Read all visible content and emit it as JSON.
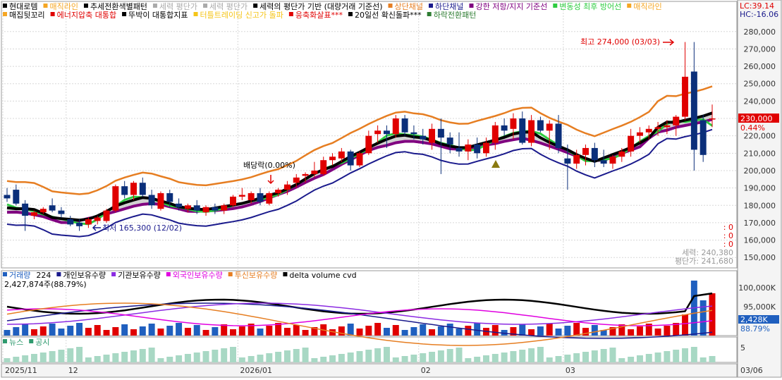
{
  "header": {
    "row1": [
      {
        "text": "현대로템",
        "color": "#000000",
        "box": "#000000"
      },
      {
        "text": "매직라인",
        "color": "#f5a623",
        "box": "#f5a623"
      },
      {
        "text": "추세전환색별패턴",
        "color": "#000000",
        "box": "#000000"
      },
      {
        "text": "세력 평단가",
        "color": "#aaaaaa",
        "box": "#aaaaaa"
      },
      {
        "text": "세력 평단가",
        "color": "#aaaaaa",
        "box": "#aaaaaa"
      },
      {
        "text": "세력의 평단가 기반 (대량거래 기준선)",
        "color": "#000000",
        "box": "#000000"
      },
      {
        "text": "상단채널",
        "color": "#e67e22",
        "box": "#e67e22"
      },
      {
        "text": "하단채널",
        "color": "#1a1a8c",
        "box": "#1a1a8c"
      },
      {
        "text": "강한 저항/지지 기준선",
        "color": "#800080",
        "box": "#800080"
      },
      {
        "text": "변동성 최후 방어선",
        "color": "#2ecc40",
        "box": "#2ecc40"
      },
      {
        "text": "매직라인",
        "color": "#f5a623",
        "box": "#f5a623"
      }
    ],
    "row2": [
      {
        "text": "매집뒷꼬리",
        "color": "#000000",
        "box": "#f5a623"
      },
      {
        "text": "에너지압축 대통합",
        "color": "#e00000",
        "box": "#e00000"
      },
      {
        "text": "뚜박이 대통합지표",
        "color": "#000000",
        "box": "#000000"
      },
      {
        "text": "터틀트레이딩 신고가 돌파",
        "color": "#f5c518",
        "box": "#f5c518"
      },
      {
        "text": "응축화살표***",
        "color": "#e00000",
        "box": "#e00000"
      },
      {
        "text": "20일선 확신돌파***",
        "color": "#000000",
        "box": "#000000"
      },
      {
        "text": "하락전환패턴",
        "color": "#2e7d32",
        "box": "#2e7d32"
      }
    ],
    "lc": "LC:39.14",
    "hc": "HC:-16.06"
  },
  "annotations": {
    "high": "최고 274,000 (03/03)",
    "low": "최저 165,300 (12/02)",
    "dividend": "배당락(0.00%)",
    "zeros": [
      ": 0",
      ": 0",
      ": 0"
    ],
    "force_price": "세력: 240,380",
    "avg_price": "평단가: 241,680"
  },
  "price_tag": {
    "value": "230,000",
    "change": "0.44%"
  },
  "volume_header": {
    "items": [
      {
        "text": "거래량",
        "color": "#1f5fbf",
        "box": "#1f5fbf"
      },
      {
        "text": "224",
        "color": "#000000",
        "box": null
      },
      {
        "text": "개인보유수량",
        "color": "#000000",
        "box": "#1a1a8c"
      },
      {
        "text": "기관보유수량",
        "color": "#000000",
        "box": "#8b2be2"
      },
      {
        "text": "외국인보유수량",
        "color": "#e000e0",
        "box": "#e000e0"
      },
      {
        "text": "투신보유수량",
        "color": "#e67e22",
        "box": "#e67e22"
      },
      {
        "text": "delta volume cvd",
        "color": "#000000",
        "box": "#000000"
      }
    ],
    "sub": "2,427,874주(88.79%)",
    "tag1": "2,428K",
    "tag2": "88.79%"
  },
  "news_header": {
    "items": [
      {
        "text": "뉴스",
        "color": "#2e9a6e",
        "box": "#2e9a6e"
      },
      {
        "text": "공시",
        "color": "#2e9a6e",
        "box": "#2e9a6e"
      }
    ]
  },
  "chart_data": {
    "type": "candlestick",
    "price_axis": {
      "ticks": [
        150000,
        160000,
        170000,
        180000,
        190000,
        200000,
        210000,
        220000,
        230000,
        240000,
        250000,
        260000,
        270000,
        280000
      ],
      "range": [
        144000,
        286000
      ]
    },
    "volume_axis": {
      "ticks": [
        "95,000K",
        "100,000K"
      ]
    },
    "news_axis": {
      "ticks": [
        "5"
      ]
    },
    "x_labels": [
      {
        "text": "2025/11",
        "i": 0
      },
      {
        "text": "12",
        "i": 7
      },
      {
        "text": "2026/01",
        "i": 26
      },
      {
        "text": "02",
        "i": 46
      },
      {
        "text": "03",
        "i": 62
      },
      {
        "text": "03/06",
        "i": 67
      }
    ],
    "candles": [
      [
        186000,
        190000,
        182000,
        184000
      ],
      [
        189000,
        192000,
        180000,
        181000
      ],
      [
        181000,
        183000,
        165300,
        174000
      ],
      [
        174000,
        177000,
        172000,
        176000
      ],
      [
        176000,
        179000,
        175000,
        178000
      ],
      [
        180000,
        184000,
        176000,
        177000
      ],
      [
        177000,
        179000,
        173000,
        175000
      ],
      [
        172000,
        174000,
        168000,
        169000
      ],
      [
        170000,
        172000,
        165300,
        168000
      ],
      [
        169000,
        173000,
        167000,
        172000
      ],
      [
        171000,
        174000,
        169000,
        173000
      ],
      [
        171000,
        178000,
        170000,
        177000
      ],
      [
        177000,
        192000,
        176000,
        191000
      ],
      [
        191000,
        194000,
        184000,
        186000
      ],
      [
        186000,
        194000,
        183000,
        193000
      ],
      [
        193000,
        196000,
        185000,
        186000
      ],
      [
        186000,
        189000,
        178000,
        180000
      ],
      [
        178000,
        188000,
        177000,
        187000
      ],
      [
        187000,
        189000,
        179000,
        182000
      ],
      [
        181000,
        184000,
        177000,
        179000
      ],
      [
        178000,
        181000,
        176000,
        180000
      ],
      [
        180000,
        183000,
        175000,
        177000
      ],
      [
        176000,
        180000,
        174000,
        179000
      ],
      [
        179000,
        181000,
        175000,
        177000
      ],
      [
        177000,
        181000,
        175000,
        180000
      ],
      [
        180000,
        186000,
        179000,
        185000
      ],
      [
        185000,
        190000,
        183000,
        186000
      ],
      [
        183000,
        188000,
        181000,
        187000
      ],
      [
        187000,
        190000,
        180000,
        182000
      ],
      [
        181000,
        188000,
        180000,
        187000
      ],
      [
        187000,
        190000,
        185000,
        189000
      ],
      [
        189000,
        194000,
        186000,
        192000
      ],
      [
        193000,
        198000,
        190000,
        196000
      ],
      [
        197000,
        199000,
        193000,
        198000
      ],
      [
        198000,
        205000,
        196000,
        200000
      ],
      [
        198000,
        208000,
        197000,
        206000
      ],
      [
        206000,
        210000,
        203000,
        208000
      ],
      [
        207000,
        213000,
        205000,
        211000
      ],
      [
        211000,
        212000,
        200000,
        203000
      ],
      [
        203000,
        211000,
        202000,
        210000
      ],
      [
        210000,
        223000,
        209000,
        220000
      ],
      [
        221000,
        226000,
        216000,
        223000
      ],
      [
        223000,
        226000,
        213000,
        221000
      ],
      [
        221000,
        232000,
        219000,
        230000
      ],
      [
        230000,
        232000,
        220000,
        222000
      ],
      [
        222000,
        226000,
        218000,
        221000
      ],
      [
        220000,
        224000,
        215000,
        218000
      ],
      [
        216000,
        227000,
        212000,
        224000
      ],
      [
        224000,
        230000,
        198000,
        219000
      ],
      [
        219000,
        222000,
        210000,
        215000
      ],
      [
        213000,
        222000,
        208000,
        211000
      ],
      [
        211000,
        218000,
        206000,
        215000
      ],
      [
        215000,
        219000,
        207000,
        210000
      ],
      [
        210000,
        219000,
        208000,
        216000
      ],
      [
        216000,
        228000,
        212000,
        226000
      ],
      [
        226000,
        230000,
        220000,
        223000
      ],
      [
        224000,
        233000,
        218000,
        230000
      ],
      [
        230000,
        234000,
        215000,
        216000
      ],
      [
        216000,
        232000,
        214000,
        229000
      ],
      [
        229000,
        231000,
        222000,
        223000
      ],
      [
        223000,
        229000,
        212000,
        227000
      ],
      [
        227000,
        232000,
        210000,
        213000
      ],
      [
        207000,
        215000,
        189000,
        204000
      ],
      [
        204000,
        212000,
        201000,
        209000
      ],
      [
        209000,
        215000,
        203000,
        213000
      ],
      [
        213000,
        216000,
        202000,
        206000
      ],
      [
        206000,
        212000,
        202000,
        204000
      ],
      [
        204000,
        209000,
        201000,
        208000
      ],
      [
        208000,
        213000,
        205000,
        211000
      ],
      [
        211000,
        224000,
        208000,
        220000
      ],
      [
        220000,
        225000,
        216000,
        222000
      ],
      [
        222000,
        226000,
        218000,
        224000
      ],
      [
        224000,
        228000,
        220000,
        225000
      ],
      [
        225000,
        229000,
        221000,
        226000
      ],
      [
        226000,
        232000,
        220000,
        231000
      ],
      [
        231000,
        274000,
        229000,
        254000
      ],
      [
        257000,
        274000,
        200000,
        212000
      ],
      [
        229000,
        232000,
        205000,
        209000
      ],
      [
        230000,
        238000,
        225000,
        230000
      ]
    ]
  }
}
